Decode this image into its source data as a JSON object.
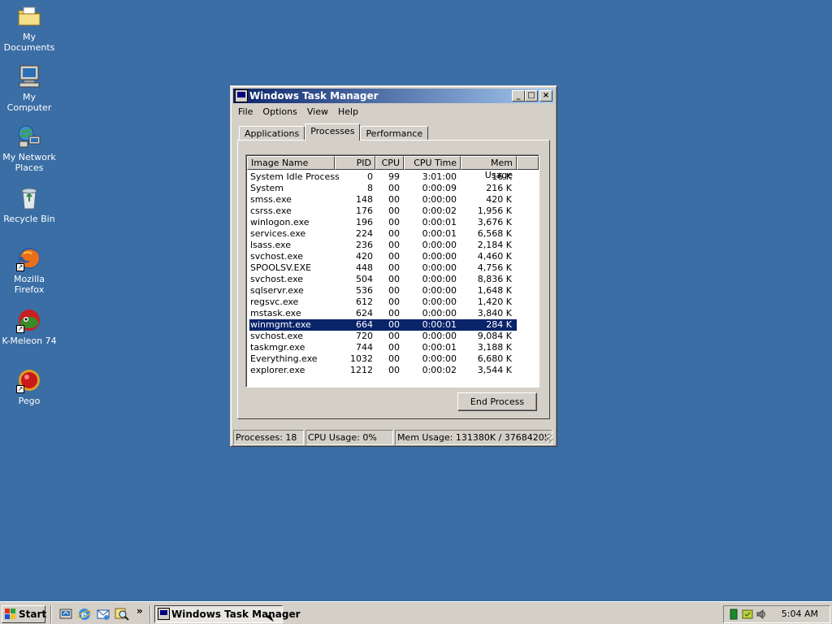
{
  "desktop": {
    "icons": [
      {
        "label": "My Documents",
        "icon": "folder-documents-icon"
      },
      {
        "label": "My Computer",
        "icon": "computer-icon"
      },
      {
        "label": "My Network Places",
        "icon": "network-icon"
      },
      {
        "label": "Recycle Bin",
        "icon": "recycle-bin-icon"
      },
      {
        "label": "Mozilla Firefox",
        "icon": "firefox-icon"
      },
      {
        "label": "K-Meleon 74",
        "icon": "kmeleon-icon"
      },
      {
        "label": "Pego",
        "icon": "pego-icon"
      }
    ]
  },
  "window": {
    "title": "Windows Task Manager",
    "buttons": {
      "minimize": "_",
      "maximize": "□",
      "close": "×"
    },
    "menu": [
      "File",
      "Options",
      "View",
      "Help"
    ],
    "tabs": [
      "Applications",
      "Processes",
      "Performance"
    ],
    "active_tab": "Processes",
    "columns": {
      "name": "Image Name",
      "pid": "PID",
      "cpu": "CPU",
      "cpu_time": "CPU Time",
      "mem": "Mem Usage"
    },
    "processes": [
      {
        "name": "System Idle Process",
        "pid": "0",
        "cpu": "99",
        "cpu_time": "3:01:00",
        "mem": "16 K"
      },
      {
        "name": "System",
        "pid": "8",
        "cpu": "00",
        "cpu_time": "0:00:09",
        "mem": "216 K"
      },
      {
        "name": "smss.exe",
        "pid": "148",
        "cpu": "00",
        "cpu_time": "0:00:00",
        "mem": "420 K"
      },
      {
        "name": "csrss.exe",
        "pid": "176",
        "cpu": "00",
        "cpu_time": "0:00:02",
        "mem": "1,956 K"
      },
      {
        "name": "winlogon.exe",
        "pid": "196",
        "cpu": "00",
        "cpu_time": "0:00:01",
        "mem": "3,676 K"
      },
      {
        "name": "services.exe",
        "pid": "224",
        "cpu": "00",
        "cpu_time": "0:00:01",
        "mem": "6,568 K"
      },
      {
        "name": "lsass.exe",
        "pid": "236",
        "cpu": "00",
        "cpu_time": "0:00:00",
        "mem": "2,184 K"
      },
      {
        "name": "svchost.exe",
        "pid": "420",
        "cpu": "00",
        "cpu_time": "0:00:00",
        "mem": "4,460 K"
      },
      {
        "name": "SPOOLSV.EXE",
        "pid": "448",
        "cpu": "00",
        "cpu_time": "0:00:00",
        "mem": "4,756 K"
      },
      {
        "name": "svchost.exe",
        "pid": "504",
        "cpu": "00",
        "cpu_time": "0:00:00",
        "mem": "8,836 K"
      },
      {
        "name": "sqlservr.exe",
        "pid": "536",
        "cpu": "00",
        "cpu_time": "0:00:00",
        "mem": "1,648 K"
      },
      {
        "name": "regsvc.exe",
        "pid": "612",
        "cpu": "00",
        "cpu_time": "0:00:00",
        "mem": "1,420 K"
      },
      {
        "name": "mstask.exe",
        "pid": "624",
        "cpu": "00",
        "cpu_time": "0:00:00",
        "mem": "3,840 K"
      },
      {
        "name": "winmgmt.exe",
        "pid": "664",
        "cpu": "00",
        "cpu_time": "0:00:01",
        "mem": "284 K",
        "selected": true
      },
      {
        "name": "svchost.exe",
        "pid": "720",
        "cpu": "00",
        "cpu_time": "0:00:00",
        "mem": "9,084 K"
      },
      {
        "name": "taskmgr.exe",
        "pid": "744",
        "cpu": "00",
        "cpu_time": "0:00:01",
        "mem": "3,188 K"
      },
      {
        "name": "Everything.exe",
        "pid": "1032",
        "cpu": "00",
        "cpu_time": "0:00:00",
        "mem": "6,680 K"
      },
      {
        "name": "explorer.exe",
        "pid": "1212",
        "cpu": "00",
        "cpu_time": "0:00:02",
        "mem": "3,544 K"
      }
    ],
    "end_process_label": "End Process",
    "status": {
      "processes": "Processes: 18",
      "cpu": "CPU Usage: 0%",
      "mem": "Mem Usage: 131380K / 3768420K"
    }
  },
  "taskbar": {
    "start_label": "Start",
    "quick_launch": [
      "desktop-icon",
      "ie-icon",
      "outlook-icon",
      "search-icon"
    ],
    "chevron": "»",
    "task_label": "Windows Task Manager",
    "tray_icons": [
      "network-tray-icon",
      "shield-tray-icon",
      "speaker-tray-icon"
    ],
    "clock": "5:04 AM"
  },
  "colors": {
    "desktop": "#3a6ea5",
    "titlebar_start": "#0a246a",
    "titlebar_end": "#a6caf0",
    "selection": "#0a246a",
    "face": "#d4d0c8"
  }
}
